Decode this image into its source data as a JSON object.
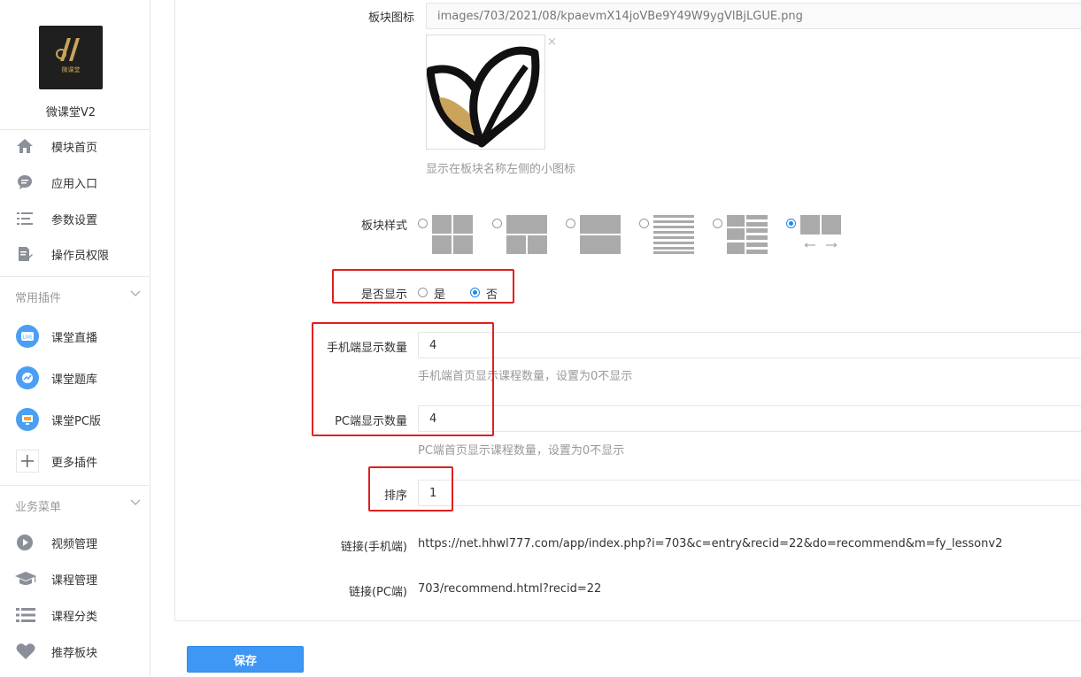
{
  "sidebar": {
    "app_name": "微课堂V2",
    "logo_text": "微课堂",
    "main_items": [
      {
        "label": "模块首页",
        "icon": "home-icon"
      },
      {
        "label": "应用入口",
        "icon": "chat-icon"
      },
      {
        "label": "参数设置",
        "icon": "list-settings-icon"
      },
      {
        "label": "操作员权限",
        "icon": "edit-doc-icon"
      }
    ],
    "group1_title": "常用插件",
    "plugins": [
      {
        "label": "课堂直播",
        "icon": "live-icon"
      },
      {
        "label": "课堂题库",
        "icon": "question-bank-icon"
      },
      {
        "label": "课堂PC版",
        "icon": "pc-icon"
      },
      {
        "label": "更多插件",
        "icon": "plus-icon"
      }
    ],
    "group2_title": "业务菜单",
    "business_items": [
      {
        "label": "视频管理",
        "icon": "play-icon"
      },
      {
        "label": "课程管理",
        "icon": "graduation-cap-icon"
      },
      {
        "label": "课程分类",
        "icon": "list-icon"
      },
      {
        "label": "推荐板块",
        "icon": "heart-icon"
      }
    ]
  },
  "form": {
    "icon_label": "板块图标",
    "icon_path": "images/703/2021/08/kpaevmX14joVBe9Y49W9ygVlBjLGUE.png",
    "icon_remove": "×",
    "icon_help": "显示在板块名称左侧的小图标",
    "style_label": "板块样式",
    "style_selected_index": 5,
    "show_label": "是否显示",
    "show_yes": "是",
    "show_no": "否",
    "show_value": "否",
    "mobile_count_label": "手机端显示数量",
    "mobile_count_value": "4",
    "mobile_count_help": "手机端首页显示课程数量，设置为0不显示",
    "pc_count_label": "PC端显示数量",
    "pc_count_value": "4",
    "pc_count_help": "PC端首页显示课程数量，设置为0不显示",
    "sort_label": "排序",
    "sort_value": "1",
    "link_mobile_label": "链接(手机端)",
    "link_mobile_value": "https://net.hhwl777.com/app/index.php?i=703&c=entry&recid=22&do=recommend&m=fy_lessonv2",
    "link_pc_label": "链接(PC端)",
    "link_pc_value": "703/recommend.html?recid=22"
  },
  "save_button": "保存",
  "colors": {
    "accent": "#3e97f5",
    "highlight": "#e02020",
    "plugin_icon": "#4a9ff5"
  }
}
